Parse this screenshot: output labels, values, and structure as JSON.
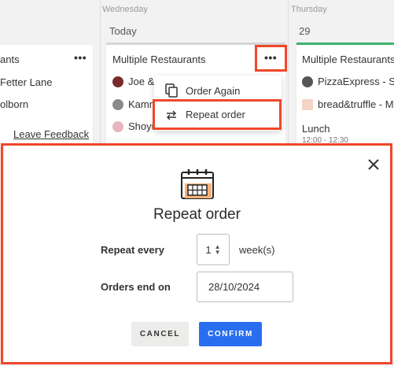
{
  "calendar": {
    "days": [
      {
        "name": "Wednesday"
      },
      {
        "name": "Thursday"
      }
    ],
    "col_heads": {
      "today": "Today",
      "thursday_date": "29"
    },
    "left_card": {
      "title_fragment": "ants",
      "rows": [
        "Fetter Lane",
        "olborn"
      ],
      "feedback": "Leave Feedback"
    },
    "middle_card": {
      "title": "Multiple Restaurants",
      "restaurants": [
        "Joe &",
        "Kamm",
        "Shoyu"
      ]
    },
    "right_card": {
      "title": "Multiple Restaurants",
      "restaurants": [
        "PizzaExpress - S",
        "bread&truffle - M"
      ],
      "meal": "Lunch",
      "time": "12:00 - 12:30"
    },
    "more_icon": "•••",
    "menu": {
      "items": [
        {
          "label": "Order Again",
          "icon": "copy-icon"
        },
        {
          "label": "Repeat order",
          "icon": "repeat-icon"
        }
      ]
    }
  },
  "modal": {
    "title": "Repeat order",
    "close_icon": "close-icon",
    "calendar_icon": "calendar-icon",
    "repeat_label": "Repeat every",
    "repeat_value": "1",
    "repeat_unit": "week(s)",
    "end_label": "Orders end on",
    "end_value": "28/10/2024",
    "cancel_label": "CANCEL",
    "confirm_label": "CONFIRM"
  },
  "colors": {
    "highlight": "#f0472a",
    "confirm": "#2a6ef0",
    "calendar_icon_fill": "#f5b27a",
    "thursday_accent": "#3cb36a"
  }
}
